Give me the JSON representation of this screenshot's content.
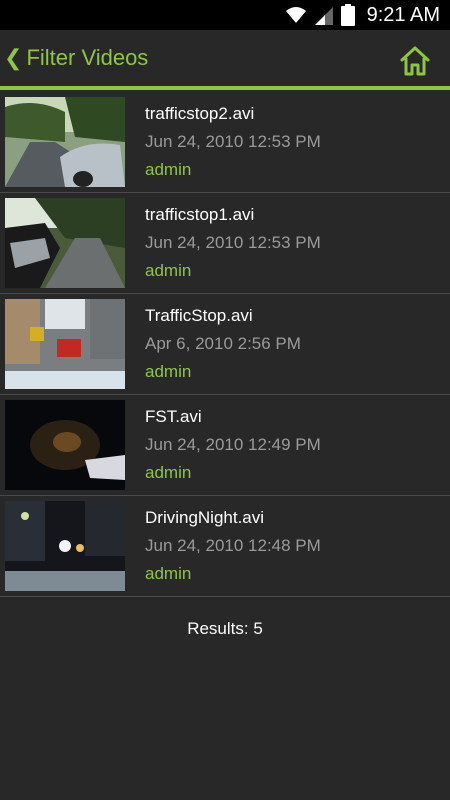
{
  "status": {
    "time": "9:21 AM"
  },
  "header": {
    "title": "Filter Videos"
  },
  "videos": [
    {
      "name": "trafficstop2.avi",
      "date": "Jun 24, 2010 12:53 PM",
      "user": "admin"
    },
    {
      "name": "trafficstop1.avi",
      "date": "Jun 24, 2010 12:53 PM",
      "user": "admin"
    },
    {
      "name": "TrafficStop.avi",
      "date": "Apr 6, 2010 2:56 PM",
      "user": "admin"
    },
    {
      "name": "FST.avi",
      "date": "Jun 24, 2010 12:49 PM",
      "user": "admin"
    },
    {
      "name": "DrivingNight.avi",
      "date": "Jun 24, 2010 12:48 PM",
      "user": "admin"
    }
  ],
  "footer": {
    "results": "Results: 5"
  },
  "colors": {
    "accent": "#8ec641",
    "background": "#282828"
  }
}
